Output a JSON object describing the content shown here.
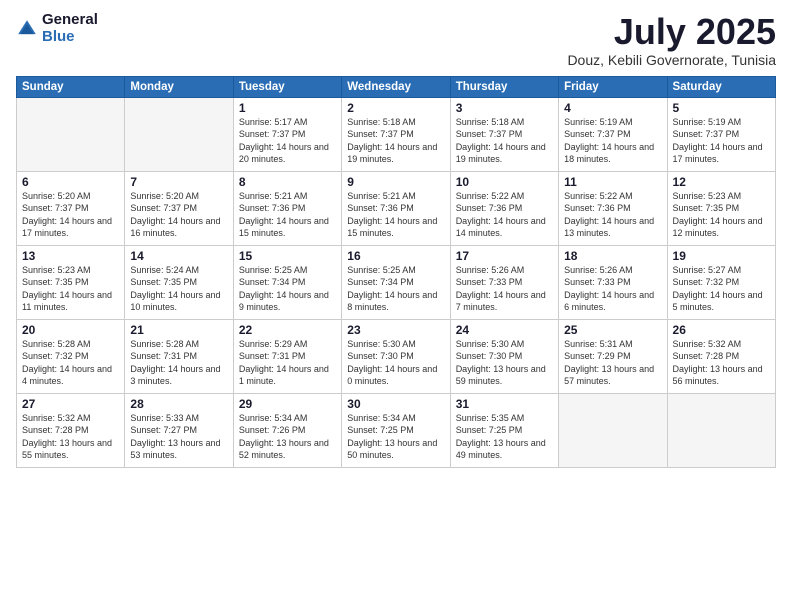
{
  "logo": {
    "general": "General",
    "blue": "Blue"
  },
  "header": {
    "month": "July 2025",
    "location": "Douz, Kebili Governorate, Tunisia"
  },
  "weekdays": [
    "Sunday",
    "Monday",
    "Tuesday",
    "Wednesday",
    "Thursday",
    "Friday",
    "Saturday"
  ],
  "weeks": [
    [
      {
        "day": "",
        "sunrise": "",
        "sunset": "",
        "daylight": ""
      },
      {
        "day": "",
        "sunrise": "",
        "sunset": "",
        "daylight": ""
      },
      {
        "day": "1",
        "sunrise": "Sunrise: 5:17 AM",
        "sunset": "Sunset: 7:37 PM",
        "daylight": "Daylight: 14 hours and 20 minutes."
      },
      {
        "day": "2",
        "sunrise": "Sunrise: 5:18 AM",
        "sunset": "Sunset: 7:37 PM",
        "daylight": "Daylight: 14 hours and 19 minutes."
      },
      {
        "day": "3",
        "sunrise": "Sunrise: 5:18 AM",
        "sunset": "Sunset: 7:37 PM",
        "daylight": "Daylight: 14 hours and 19 minutes."
      },
      {
        "day": "4",
        "sunrise": "Sunrise: 5:19 AM",
        "sunset": "Sunset: 7:37 PM",
        "daylight": "Daylight: 14 hours and 18 minutes."
      },
      {
        "day": "5",
        "sunrise": "Sunrise: 5:19 AM",
        "sunset": "Sunset: 7:37 PM",
        "daylight": "Daylight: 14 hours and 17 minutes."
      }
    ],
    [
      {
        "day": "6",
        "sunrise": "Sunrise: 5:20 AM",
        "sunset": "Sunset: 7:37 PM",
        "daylight": "Daylight: 14 hours and 17 minutes."
      },
      {
        "day": "7",
        "sunrise": "Sunrise: 5:20 AM",
        "sunset": "Sunset: 7:37 PM",
        "daylight": "Daylight: 14 hours and 16 minutes."
      },
      {
        "day": "8",
        "sunrise": "Sunrise: 5:21 AM",
        "sunset": "Sunset: 7:36 PM",
        "daylight": "Daylight: 14 hours and 15 minutes."
      },
      {
        "day": "9",
        "sunrise": "Sunrise: 5:21 AM",
        "sunset": "Sunset: 7:36 PM",
        "daylight": "Daylight: 14 hours and 15 minutes."
      },
      {
        "day": "10",
        "sunrise": "Sunrise: 5:22 AM",
        "sunset": "Sunset: 7:36 PM",
        "daylight": "Daylight: 14 hours and 14 minutes."
      },
      {
        "day": "11",
        "sunrise": "Sunrise: 5:22 AM",
        "sunset": "Sunset: 7:36 PM",
        "daylight": "Daylight: 14 hours and 13 minutes."
      },
      {
        "day": "12",
        "sunrise": "Sunrise: 5:23 AM",
        "sunset": "Sunset: 7:35 PM",
        "daylight": "Daylight: 14 hours and 12 minutes."
      }
    ],
    [
      {
        "day": "13",
        "sunrise": "Sunrise: 5:23 AM",
        "sunset": "Sunset: 7:35 PM",
        "daylight": "Daylight: 14 hours and 11 minutes."
      },
      {
        "day": "14",
        "sunrise": "Sunrise: 5:24 AM",
        "sunset": "Sunset: 7:35 PM",
        "daylight": "Daylight: 14 hours and 10 minutes."
      },
      {
        "day": "15",
        "sunrise": "Sunrise: 5:25 AM",
        "sunset": "Sunset: 7:34 PM",
        "daylight": "Daylight: 14 hours and 9 minutes."
      },
      {
        "day": "16",
        "sunrise": "Sunrise: 5:25 AM",
        "sunset": "Sunset: 7:34 PM",
        "daylight": "Daylight: 14 hours and 8 minutes."
      },
      {
        "day": "17",
        "sunrise": "Sunrise: 5:26 AM",
        "sunset": "Sunset: 7:33 PM",
        "daylight": "Daylight: 14 hours and 7 minutes."
      },
      {
        "day": "18",
        "sunrise": "Sunrise: 5:26 AM",
        "sunset": "Sunset: 7:33 PM",
        "daylight": "Daylight: 14 hours and 6 minutes."
      },
      {
        "day": "19",
        "sunrise": "Sunrise: 5:27 AM",
        "sunset": "Sunset: 7:32 PM",
        "daylight": "Daylight: 14 hours and 5 minutes."
      }
    ],
    [
      {
        "day": "20",
        "sunrise": "Sunrise: 5:28 AM",
        "sunset": "Sunset: 7:32 PM",
        "daylight": "Daylight: 14 hours and 4 minutes."
      },
      {
        "day": "21",
        "sunrise": "Sunrise: 5:28 AM",
        "sunset": "Sunset: 7:31 PM",
        "daylight": "Daylight: 14 hours and 3 minutes."
      },
      {
        "day": "22",
        "sunrise": "Sunrise: 5:29 AM",
        "sunset": "Sunset: 7:31 PM",
        "daylight": "Daylight: 14 hours and 1 minute."
      },
      {
        "day": "23",
        "sunrise": "Sunrise: 5:30 AM",
        "sunset": "Sunset: 7:30 PM",
        "daylight": "Daylight: 14 hours and 0 minutes."
      },
      {
        "day": "24",
        "sunrise": "Sunrise: 5:30 AM",
        "sunset": "Sunset: 7:30 PM",
        "daylight": "Daylight: 13 hours and 59 minutes."
      },
      {
        "day": "25",
        "sunrise": "Sunrise: 5:31 AM",
        "sunset": "Sunset: 7:29 PM",
        "daylight": "Daylight: 13 hours and 57 minutes."
      },
      {
        "day": "26",
        "sunrise": "Sunrise: 5:32 AM",
        "sunset": "Sunset: 7:28 PM",
        "daylight": "Daylight: 13 hours and 56 minutes."
      }
    ],
    [
      {
        "day": "27",
        "sunrise": "Sunrise: 5:32 AM",
        "sunset": "Sunset: 7:28 PM",
        "daylight": "Daylight: 13 hours and 55 minutes."
      },
      {
        "day": "28",
        "sunrise": "Sunrise: 5:33 AM",
        "sunset": "Sunset: 7:27 PM",
        "daylight": "Daylight: 13 hours and 53 minutes."
      },
      {
        "day": "29",
        "sunrise": "Sunrise: 5:34 AM",
        "sunset": "Sunset: 7:26 PM",
        "daylight": "Daylight: 13 hours and 52 minutes."
      },
      {
        "day": "30",
        "sunrise": "Sunrise: 5:34 AM",
        "sunset": "Sunset: 7:25 PM",
        "daylight": "Daylight: 13 hours and 50 minutes."
      },
      {
        "day": "31",
        "sunrise": "Sunrise: 5:35 AM",
        "sunset": "Sunset: 7:25 PM",
        "daylight": "Daylight: 13 hours and 49 minutes."
      },
      {
        "day": "",
        "sunrise": "",
        "sunset": "",
        "daylight": ""
      },
      {
        "day": "",
        "sunrise": "",
        "sunset": "",
        "daylight": ""
      }
    ]
  ]
}
